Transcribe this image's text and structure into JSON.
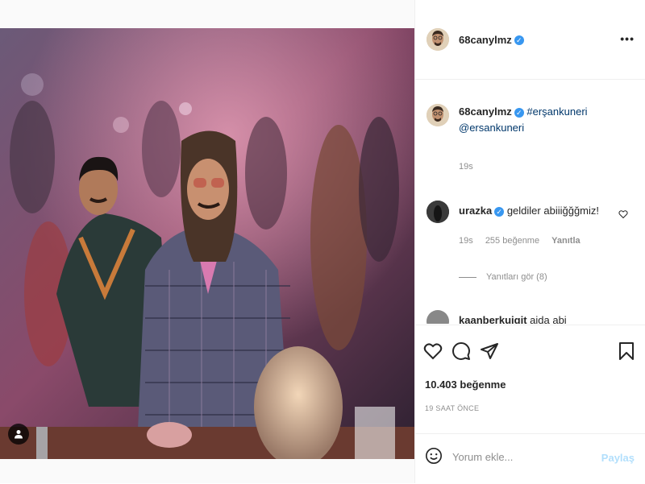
{
  "post": {
    "author": "68canylmz",
    "author_verified": true
  },
  "header": {
    "more_label": "•••"
  },
  "caption": {
    "username": "68canylmz",
    "hashtag": "#erşankuneri",
    "mention": "@ersankuneri",
    "time": "19s"
  },
  "comments": [
    {
      "username": "urazka",
      "verified": true,
      "text": "geldiler abiiiğğğmiz!",
      "time": "19s",
      "likes": "255 beğenme",
      "reply_label": "Yanıtla",
      "view_replies": "Yanıtları gör (8)"
    },
    {
      "username": "kaanberkuigit",
      "text": "aida abi"
    }
  ],
  "actions": {
    "likes_count": "10.403 beğenme",
    "posted_ago": "19 SAAT ÖNCE"
  },
  "comment_form": {
    "placeholder": "Yorum ekle...",
    "share_label": "Paylaş"
  },
  "colors": {
    "link": "#00376b",
    "verified": "#3897f0",
    "share_disabled": "#b2dffc",
    "muted": "#8e8e8e"
  }
}
